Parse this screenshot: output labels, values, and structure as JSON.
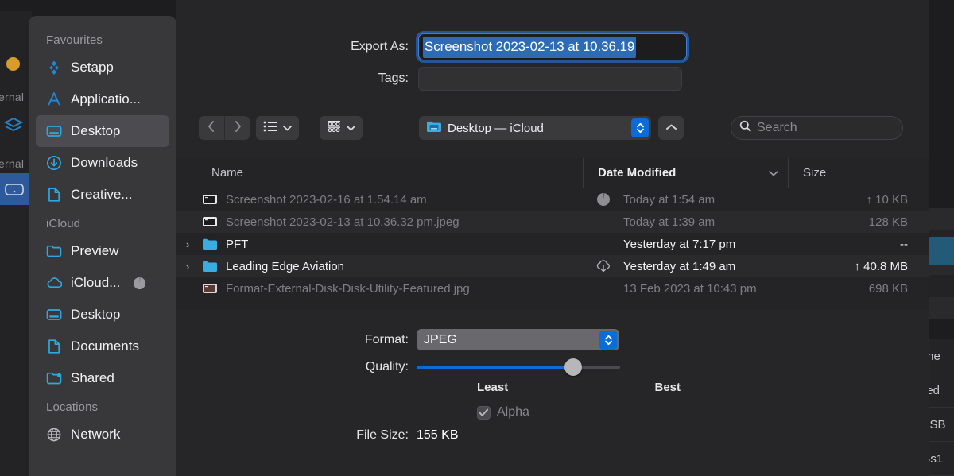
{
  "background": {
    "left_sidebar": {
      "label_top": "ernal",
      "label_bottom": "ernal",
      "layers_icon": "layers-icon",
      "drive_icon": "external-drive-icon",
      "traffic_light": "minimize-traffic-light"
    },
    "right_panel_fragments": [
      "me",
      "led",
      "JSB",
      "4s1"
    ]
  },
  "sidebar": {
    "sections": [
      {
        "title": "Favourites",
        "items": [
          {
            "label": "Setapp",
            "icon": "setapp-icon",
            "selected": false
          },
          {
            "label": "Applicatio...",
            "icon": "applications-icon",
            "selected": false
          },
          {
            "label": "Desktop",
            "icon": "desktop-icon",
            "selected": true
          },
          {
            "label": "Downloads",
            "icon": "downloads-icon",
            "selected": false
          },
          {
            "label": "Creative...",
            "icon": "document-icon",
            "selected": false
          }
        ]
      },
      {
        "title": "iCloud",
        "items": [
          {
            "label": "Preview",
            "icon": "folder-icon",
            "selected": false
          },
          {
            "label": "iCloud...",
            "icon": "icloud-icon",
            "selected": false,
            "badge": "sync-progress-icon"
          },
          {
            "label": "Desktop",
            "icon": "desktop-icon",
            "selected": false
          },
          {
            "label": "Documents",
            "icon": "document-icon",
            "selected": false
          },
          {
            "label": "Shared",
            "icon": "shared-folder-icon",
            "selected": false
          }
        ]
      },
      {
        "title": "Locations",
        "items": [
          {
            "label": "Network",
            "icon": "globe-icon",
            "selected": false
          }
        ]
      }
    ]
  },
  "form": {
    "export_as_label": "Export As:",
    "export_as_value": "Screenshot 2023-02-13 at 10.36.19",
    "tags_label": "Tags:",
    "tags_value": "",
    "tags_placeholder": ""
  },
  "toolbar": {
    "back_icon": "chevron-left-icon",
    "forward_icon": "chevron-right-icon",
    "view_icon": "list-view-icon",
    "view_chevron": "chevron-down-icon",
    "group_icon": "group-view-icon",
    "group_chevron": "chevron-down-icon",
    "path_icon": "desktop-folder-icon",
    "path_label": "Desktop — iCloud",
    "path_stepper": "stepper-updown-icon",
    "up_icon": "chevron-up-icon",
    "search_icon": "search-icon",
    "search_placeholder": "Search",
    "search_value": ""
  },
  "file_list": {
    "columns": [
      {
        "label": "Name",
        "sorted": false
      },
      {
        "label": "Date Modified",
        "sorted": true,
        "sort_icon": "chevron-down-icon"
      },
      {
        "label": "Size",
        "sorted": false
      }
    ],
    "rows": [
      {
        "name": "Screenshot 2023-02-16 at 1.54.14 am",
        "icon": "image-file-icon",
        "status_icon": "sync-progress-icon",
        "date": "Today at 1:54 am",
        "size": "↑ 10 KB",
        "dimmed": true,
        "expandable": false,
        "striped": false
      },
      {
        "name": "Screenshot 2023-02-13 at 10.36.32 pm.jpeg",
        "icon": "image-file-icon",
        "status_icon": "",
        "date": "Today at 1:39 am",
        "size": "128 KB",
        "dimmed": true,
        "expandable": false,
        "striped": true
      },
      {
        "name": "PFT",
        "icon": "folder-icon",
        "status_icon": "",
        "date": "Yesterday at 7:17 pm",
        "size": "--",
        "dimmed": false,
        "expandable": true,
        "striped": false
      },
      {
        "name": "Leading Edge Aviation",
        "icon": "folder-icon",
        "status_icon": "cloud-download-icon",
        "date": "Yesterday at 1:49 am",
        "size": "↑ 40.8 MB",
        "dimmed": false,
        "expandable": true,
        "striped": true
      },
      {
        "name": "Format-External-Disk-Disk-Utility-Featured.jpg",
        "icon": "image-file-icon",
        "status_icon": "",
        "date": "13 Feb 2023 at 10:43 pm",
        "size": "698 KB",
        "dimmed": true,
        "expandable": false,
        "striped": false
      }
    ]
  },
  "options": {
    "format_label": "Format:",
    "format_value": "JPEG",
    "format_stepper": "stepper-updown-icon",
    "quality_label": "Quality:",
    "quality_min_label": "Least",
    "quality_max_label": "Best",
    "quality_percent": 76,
    "alpha_label": "Alpha",
    "alpha_checked": true,
    "alpha_enabled": false,
    "file_size_label": "File Size:",
    "file_size_value": "155 KB"
  },
  "colors": {
    "accent_blue": "#0a6cd8",
    "selection_blue": "#2e6bb5",
    "folder_blue": "#3aade0",
    "sheet_bg": "#262628",
    "sidebar_bg": "#38383b",
    "list_bg": "#242426"
  }
}
